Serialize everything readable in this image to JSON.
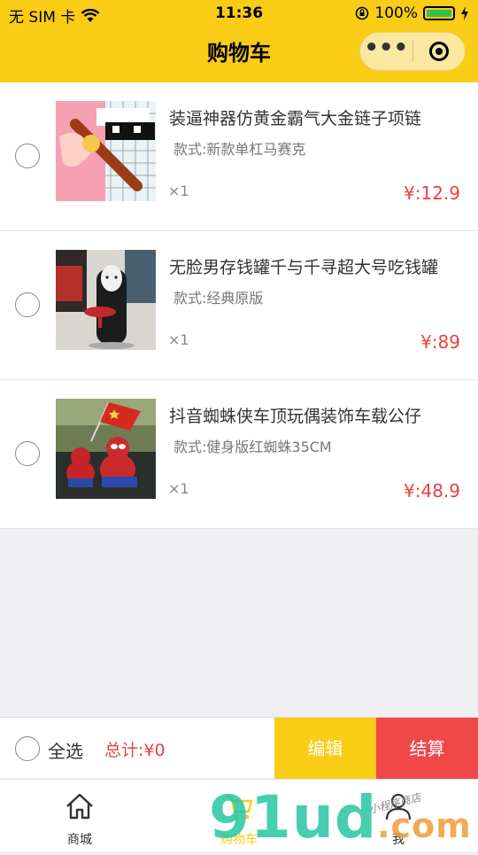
{
  "status": {
    "carrier": "无 SIM 卡",
    "time": "11:36",
    "battery": "100%"
  },
  "header": {
    "title": "购物车",
    "more_icon": "•••"
  },
  "cart": {
    "items": [
      {
        "name": "装逼神器仿黄金霸气大金链子项链",
        "spec": "款式:新款单杠马赛克",
        "qty": "×1",
        "price": "¥:12.9"
      },
      {
        "name": "无脸男存钱罐千与千寻超大号吃钱罐",
        "spec": "款式:经典原版",
        "qty": "×1",
        "price": "¥:89"
      },
      {
        "name": "抖音蜘蛛侠车顶玩偶装饰车载公仔",
        "spec": "款式:健身版红蜘蛛35CM",
        "qty": "×1",
        "price": "¥:48.9"
      }
    ]
  },
  "footer": {
    "select_all": "全选",
    "total": "总计:¥0",
    "edit": "编辑",
    "checkout": "结算"
  },
  "tabs": [
    {
      "label": "商城",
      "icon": "home-icon"
    },
    {
      "label": "购物车",
      "icon": "cart-icon"
    },
    {
      "label": "我",
      "icon": "user-icon"
    }
  ],
  "watermark": {
    "text": "91ud",
    "suffix": ".com",
    "tagline": "小程序商店"
  },
  "colors": {
    "accent": "#f9cc16",
    "price": "#e64340",
    "checkout": "#f04848"
  }
}
